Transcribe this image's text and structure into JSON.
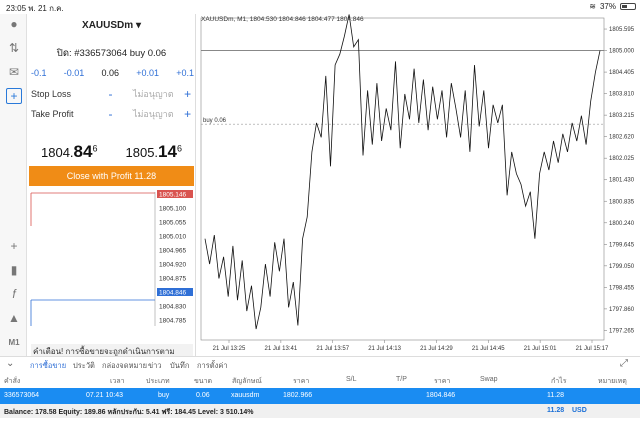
{
  "status": {
    "time": "23:05",
    "date": "พ. 21 ก.ค.",
    "battery": "37%"
  },
  "panel": {
    "symbol": "XAUUSDm",
    "order_line": "ปิด: #336573064 buy 0.06",
    "volume": {
      "m01": "-0.1",
      "m001": "-0.01",
      "value": "0.06",
      "p001": "+0.01",
      "p01": "+0.1"
    },
    "sl_label": "Stop Loss",
    "tp_label": "Take Profit",
    "not_allowed": "ไม่อนุญาต",
    "bid": {
      "main": "1804.",
      "big": "84",
      "sup": "6"
    },
    "ask": {
      "main": "1805.",
      "big": "14",
      "sup": "6"
    },
    "close_button": "Close with Profit 11.28",
    "depth_levels": [
      "1805.146",
      "1805.100",
      "1805.055",
      "1805.010",
      "1804.965",
      "1804.920",
      "1804.875",
      "1804.846",
      "1804.830",
      "1804.785"
    ],
    "warning": "คำเตือน! การซื้อขายจะถูกดำเนินการตามสภาพตลาด ความแตกต่างกับราคาที่ส่งอาจมีมาก!"
  },
  "chart_data": {
    "type": "line",
    "header": "XAUUSDm, M1, 1804.530 1804.846 1804.477 1804.846",
    "y_ticks": [
      "1805.595",
      "1805.000",
      "1804.405",
      "1803.810",
      "1803.215",
      "1802.620",
      "1802.025",
      "1801.430",
      "1800.835",
      "1800.240",
      "1799.645",
      "1799.050",
      "1798.455",
      "1797.860",
      "1797.265"
    ],
    "x_labels": [
      "21 Jul 13:25",
      "21 Jul 13:41",
      "21 Jul 13:57",
      "21 Jul 14:13",
      "21 Jul 14:29",
      "21 Jul 14:45",
      "21 Jul 15:01",
      "21 Jul 15:17"
    ],
    "current_price": "1805.000",
    "order_line": "buy 0.06",
    "order_price": 1802.966,
    "ylim": [
      1797.0,
      1805.9
    ],
    "values": [
      1799.8,
      1799.1,
      1799.9,
      1798.7,
      1799.3,
      1798.2,
      1799.6,
      1798.1,
      1799.2,
      1797.8,
      1798.5,
      1797.3,
      1797.9,
      1799.1,
      1798.2,
      1799.7,
      1798.9,
      1799.8,
      1797.9,
      1798.6,
      1797.4,
      1799.8,
      1800.4,
      1802.2,
      1803.0,
      1802.6,
      1804.3,
      1801.8,
      1804.6,
      1804.9,
      1805.4,
      1806.0,
      1805.1,
      1805.3,
      1802.1,
      1803.9,
      1802.4,
      1804.1,
      1802.5,
      1803.4,
      1802.8,
      1804.7,
      1802.3,
      1803.8,
      1803.1,
      1804.5,
      1803.0,
      1804.2,
      1802.8,
      1804.0,
      1803.1,
      1803.9,
      1802.6,
      1804.1,
      1803.4,
      1802.6,
      1803.9,
      1802.2,
      1804.6,
      1802.9,
      1803.9,
      1802.3,
      1803.5,
      1803.0,
      1803.5,
      1801.0,
      1802.2,
      1801.6,
      1801.3,
      1800.7,
      1801.1,
      1799.8,
      1801.6,
      1802.2,
      1801.7,
      1802.5,
      1801.9,
      1802.7,
      1802.2,
      1803.0,
      1802.5,
      1803.2,
      1802.4,
      1803.6,
      1804.4,
      1805.0
    ]
  },
  "tabs": [
    "การซื้อขาย",
    "ประวัติ",
    "กล่องจดหมาย",
    "ข่าว",
    "บันทึก",
    "การตั้งค่า"
  ],
  "table": {
    "headers": [
      "คำสั่ง",
      "เวลา",
      "ประเภท",
      "ขนาด",
      "สัญลักษณ์",
      "ราคา",
      "S/L",
      "T/P",
      "ราคา",
      "Swap",
      "กำไร",
      "หมายเหตุ"
    ],
    "row": {
      "order": "336573064",
      "time": "07.21 10:43",
      "type": "buy",
      "size": "0.06",
      "symbol": "xauusdm",
      "price": "1802.966",
      "price2": "1804.846",
      "profit": "11.28"
    },
    "balance": "Balance: 178.58 Equity: 189.86 หลักประกัน: 5.41 ฟรี: 184.45 Level: 3 510.14%",
    "total_profit": "11.28",
    "currency": "USD"
  }
}
